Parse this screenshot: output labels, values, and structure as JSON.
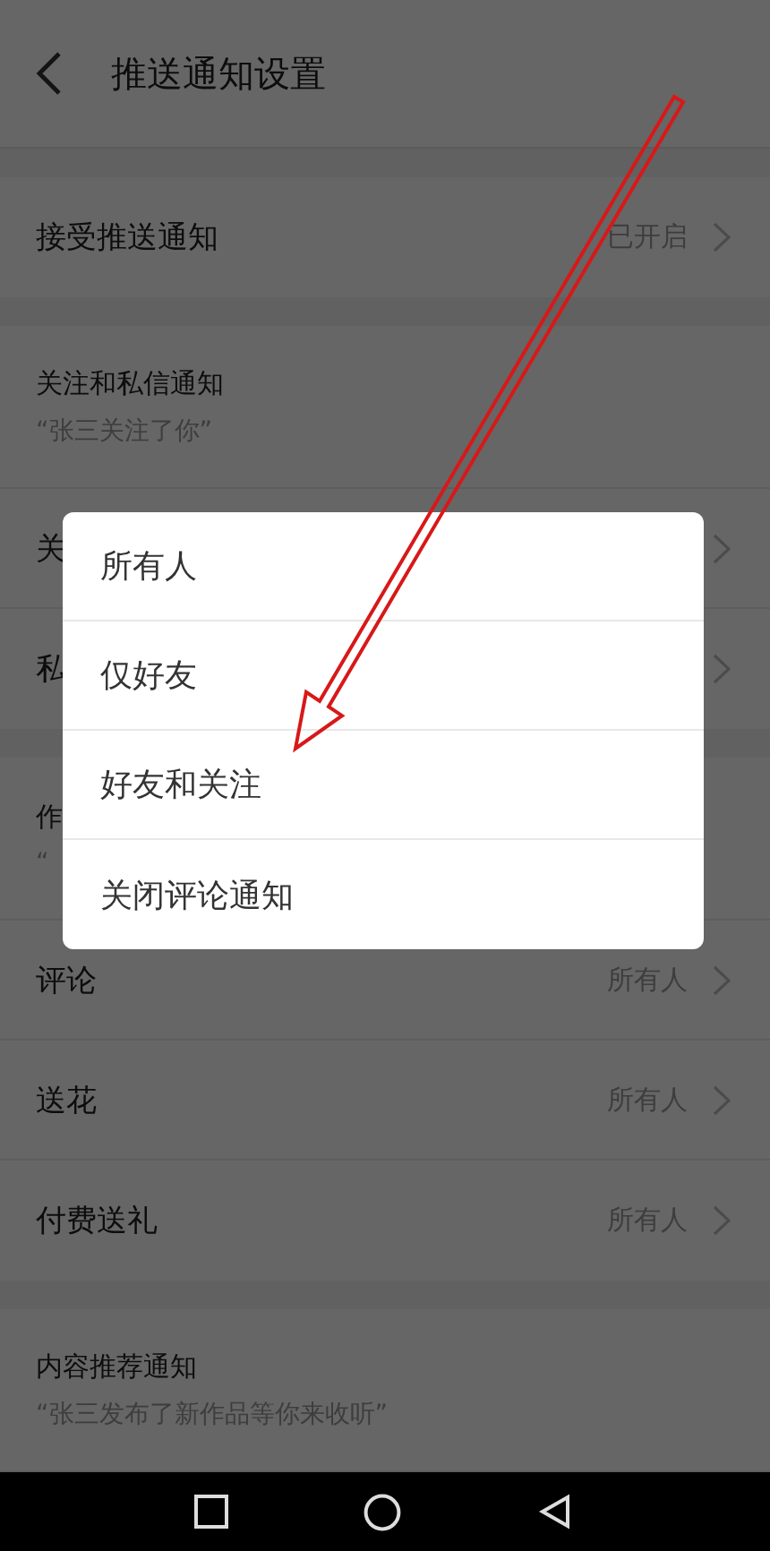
{
  "header": {
    "title": "推送通知设置"
  },
  "sections": [
    {
      "rows": [
        {
          "kind": "setting",
          "label": "接受推送通知",
          "value": "已开启"
        }
      ]
    },
    {
      "rows": [
        {
          "kind": "heading",
          "label": "关注和私信通知",
          "subtitle": "“张三关注了你”"
        },
        {
          "kind": "setting",
          "label": "关"
        },
        {
          "kind": "setting",
          "label": "私"
        }
      ]
    },
    {
      "rows": [
        {
          "kind": "heading",
          "label": "作",
          "subtitle": "“"
        },
        {
          "kind": "setting",
          "label": "评论",
          "value": "所有人"
        },
        {
          "kind": "setting",
          "label": "送花",
          "value": "所有人"
        },
        {
          "kind": "setting",
          "label": "付费送礼",
          "value": "所有人"
        }
      ]
    },
    {
      "rows": [
        {
          "kind": "heading",
          "label": "内容推荐通知",
          "subtitle": "“张三发布了新作品等你来收听”"
        }
      ]
    }
  ],
  "dialog": {
    "options": [
      "所有人",
      "仅好友",
      "好友和关注",
      "关闭评论通知"
    ]
  }
}
